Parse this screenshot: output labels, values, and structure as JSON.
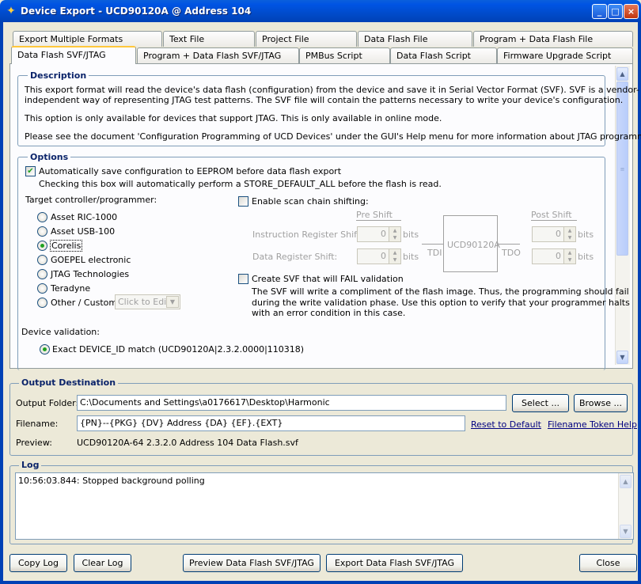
{
  "window": {
    "title": "Device Export - UCD90120A @ Address 104",
    "icon": "ti-logo-icon",
    "minimize": "_",
    "maximize": "□",
    "close": "×"
  },
  "tabs_row1": [
    "Export Multiple Formats",
    "Text File",
    "Project File",
    "Data Flash File",
    "Program + Data Flash File"
  ],
  "tabs_row2": [
    "Data Flash SVF/JTAG",
    "Program + Data Flash SVF/JTAG",
    "PMBus Script",
    "Data Flash Script",
    "Firmware Upgrade Script"
  ],
  "description": {
    "legend": "Description",
    "p1a": "This export format will read the device's data flash (configuration) from the device and save it in Serial Vector Format (SVF). SVF is a vendor-",
    "p1b": "independent way of representing JTAG test patterns. The SVF file will contain the patterns necessary to write your device's configuration.",
    "p2": "This option is only available for devices that support JTAG. This is only available in online mode.",
    "p3": "Please see the document 'Configuration Programming of UCD Devices' under the GUI's Help menu for more information about JTAG programming."
  },
  "options": {
    "legend": "Options",
    "autosave_label": "Automatically save configuration to EEPROM before data flash export",
    "autosave_checked": true,
    "autosave_note": "Checking this box will automatically perform a STORE_DEFAULT_ALL before the flash is read.",
    "target_label": "Target controller/programmer:",
    "programmers": [
      "Asset RIC-1000",
      "Asset USB-100",
      "Corelis",
      "GOEPEL electronic",
      "JTAG Technologies",
      "Teradyne",
      "Other / Custom"
    ],
    "selected_programmer": "Corelis",
    "custom_placeholder": "Click to Edit",
    "scan_chain_label": "Enable scan chain shifting:",
    "pre_shift": "Pre Shift",
    "post_shift": "Post Shift",
    "ir_label": "Instruction Register Shift:",
    "dr_label": "Data Register Shift:",
    "ir_pre": "0",
    "dr_pre": "0",
    "ir_post": "0",
    "dr_post": "0",
    "bits": "bits",
    "device": "UCD90120A",
    "tdi": "TDI",
    "tdo": "TDO",
    "fail_label": "Create SVF that will FAIL validation",
    "fail_note1": "The SVF will write a compliment of the flash image. Thus, the programming should fail",
    "fail_note2": "during the write validation phase. Use this option to verify that your programmer halts",
    "fail_note3": "with an error condition in this case.",
    "validation_label": "Device validation:",
    "validation_option": "Exact DEVICE_ID match (UCD90120A|2.3.2.0000|110318)"
  },
  "output": {
    "legend": "Output Destination",
    "folder_label": "Output Folder:",
    "folder_value": "C:\\Documents and Settings\\a0176617\\Desktop\\Harmonic",
    "select_button": "Select ...",
    "browse_button": "Browse ...",
    "filename_label": "Filename:",
    "filename_value": "{PN}--{PKG} {DV} Address {DA} {EF}.{EXT}",
    "reset_link": "Reset to Default",
    "token_link": "Filename Token Help",
    "preview_label": "Preview:",
    "preview_value": "UCD90120A-64 2.3.2.0 Address 104 Data Flash.svf"
  },
  "log": {
    "legend": "Log",
    "lines": [
      "10:56:03.844: Stopped background polling"
    ]
  },
  "buttons": {
    "copy_log": "Copy Log",
    "clear_log": "Clear Log",
    "preview": "Preview Data Flash SVF/JTAG",
    "export": "Export Data Flash SVF/JTAG",
    "close": "Close"
  },
  "colors": {
    "titlebar": "#0054e3",
    "legend_text": "#0b246a",
    "window_bg": "#ece9d8",
    "active_tab_accent": "#ffc83c"
  }
}
